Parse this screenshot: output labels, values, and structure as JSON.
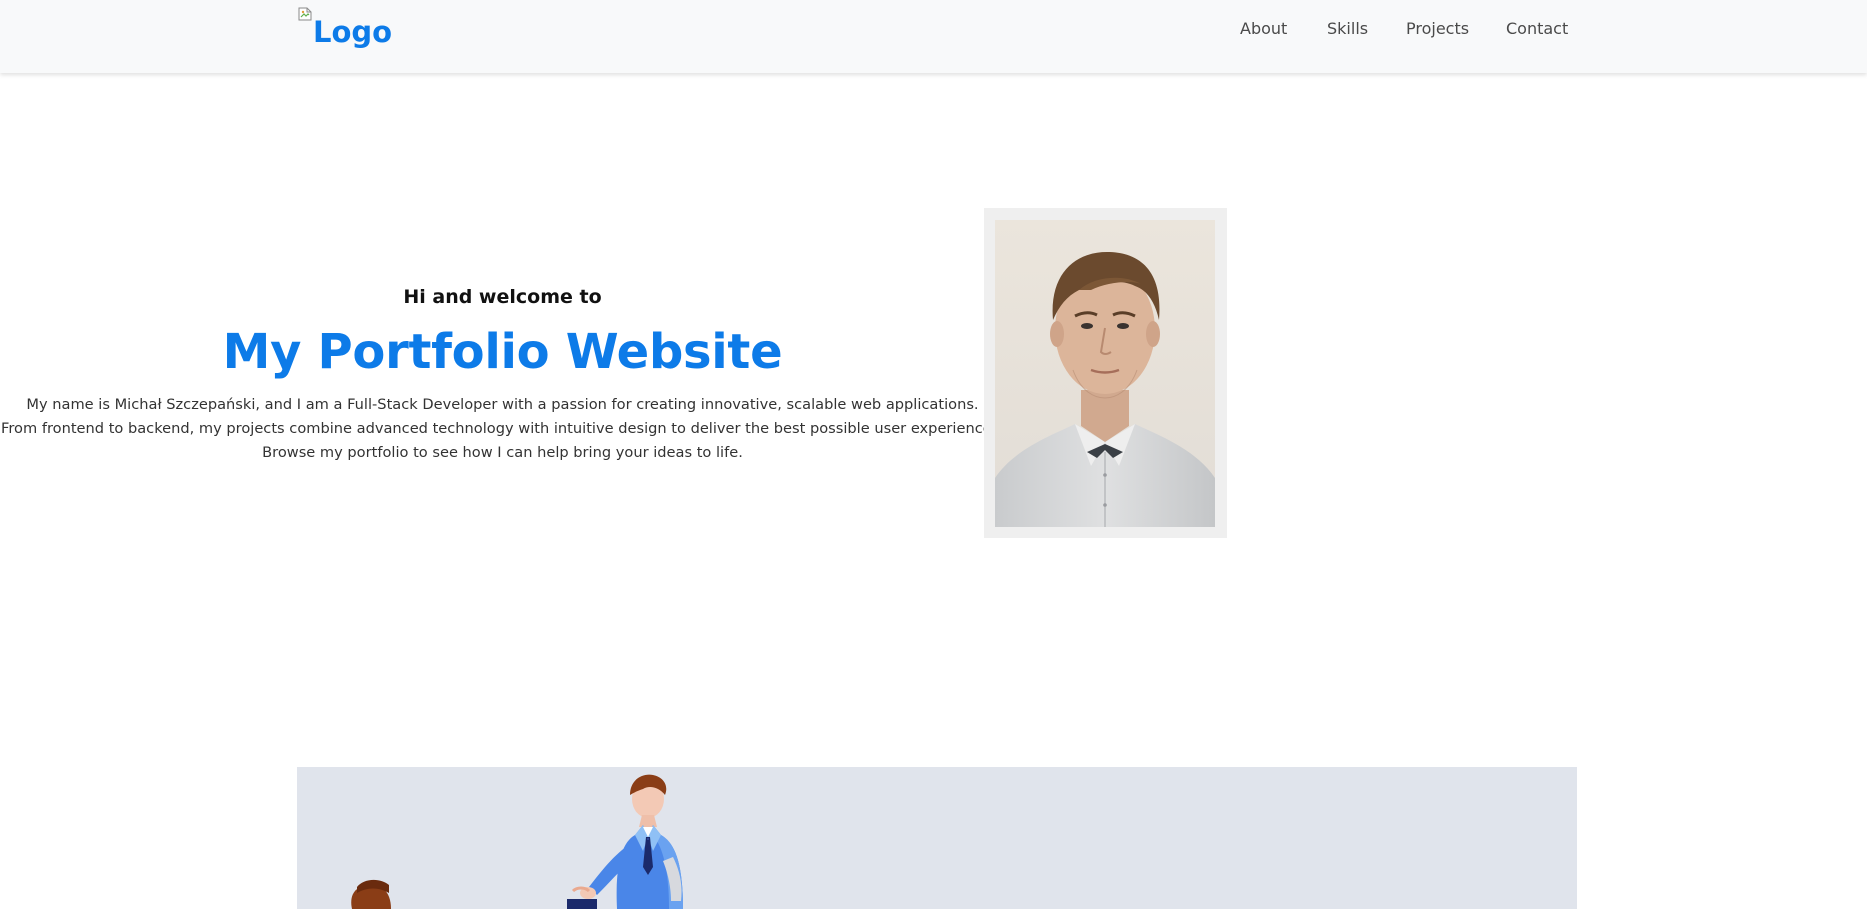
{
  "navbar": {
    "logo_alt": "Logo",
    "links": [
      "About",
      "Skills",
      "Projects",
      "Contact"
    ]
  },
  "hero": {
    "greeting": "Hi and welcome to",
    "title": "My Portfolio Website",
    "description_lines": [
      "My name is Michał Szczepański, and I am a Full-Stack Developer with a passion for creating innovative, scalable web applications.",
      "From frontend to backend, my projects combine advanced technology with intuitive design to deliver the best possible user experiences.",
      "Browse my portfolio to see how I can help bring your ideas to life."
    ]
  },
  "colors": {
    "accent": "#0d7be8",
    "navbar_bg": "#f8f9fa",
    "panel_bg": "#e0e4ec"
  },
  "icons": {
    "logo_image": "broken-image-icon",
    "profile_photo": "portrait-photo",
    "illustration": "business-people-illustration"
  }
}
